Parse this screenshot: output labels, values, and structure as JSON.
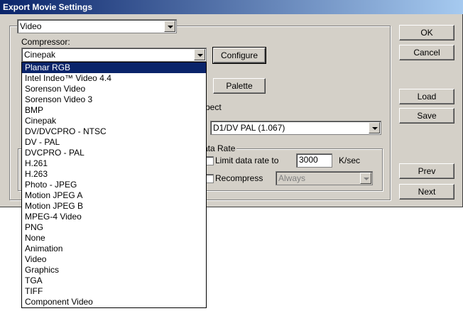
{
  "window": {
    "title": "Export Movie Settings"
  },
  "section_select": {
    "value": "Video"
  },
  "compressor": {
    "label": "Compressor:",
    "value": "Cinepak",
    "configure_label": "Configure",
    "palette_label": "Palette",
    "options": [
      "Planar RGB",
      "Intel Indeo™ Video 4.4",
      "Sorenson Video",
      "Sorenson Video 3",
      "BMP",
      "Cinepak",
      "DV/DVCPRO - NTSC",
      "DV - PAL",
      "DVCPRO - PAL",
      "H.261",
      "H.263",
      "Photo - JPEG",
      "Motion JPEG A",
      "Motion JPEG B",
      "MPEG-4 Video",
      "PNG",
      "None",
      "Animation",
      "Video",
      "Graphics",
      "TGA",
      "TIFF",
      "Component Video"
    ],
    "selected_option": "Planar RGB"
  },
  "aspect": {
    "label_fragment": "pect",
    "value": "D1/DV PAL (1.067)"
  },
  "data_rate": {
    "group_label_fragment": "ata Rate",
    "limit_label": "Limit data rate to",
    "limit_value": "3000",
    "unit": "K/sec",
    "recompress_label": "Recompress",
    "recompress_value": "Always"
  },
  "buttons": {
    "ok": "OK",
    "cancel": "Cancel",
    "load": "Load",
    "save": "Save",
    "prev": "Prev",
    "next": "Next"
  }
}
